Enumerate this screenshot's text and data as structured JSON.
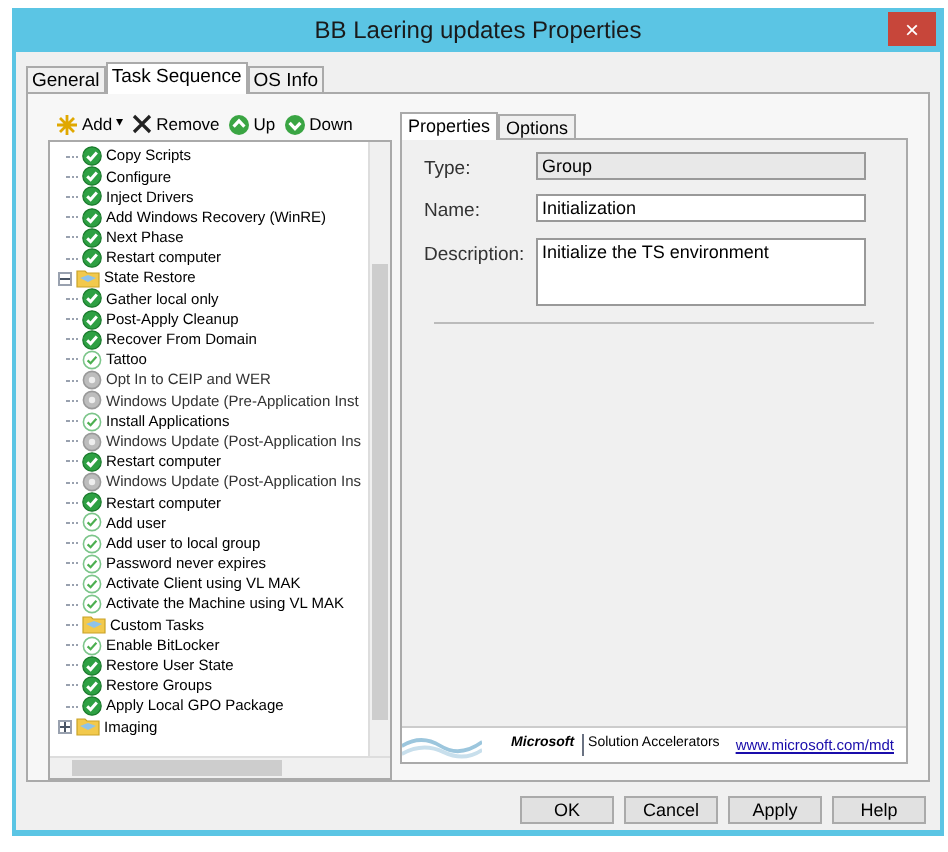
{
  "window": {
    "title": "BB Laering updates Properties",
    "close": "×"
  },
  "tabs": [
    {
      "label": "General",
      "selected": false
    },
    {
      "label": "Task Sequence",
      "selected": true
    },
    {
      "label": "OS Info",
      "selected": false
    }
  ],
  "toolbar": [
    {
      "kind": "add",
      "label": "Add",
      "caret": "▾"
    },
    {
      "kind": "remove",
      "label": "Remove"
    },
    {
      "kind": "up",
      "label": "Up"
    },
    {
      "kind": "down",
      "label": "Down"
    }
  ],
  "tree": [
    {
      "kind": "continued",
      "children": [
        {
          "kind": "step",
          "label": "Copy Scripts"
        },
        {
          "kind": "step",
          "label": "Configure"
        },
        {
          "kind": "step",
          "label": "Inject Drivers"
        },
        {
          "kind": "step",
          "label": "Add Windows Recovery (WinRE)"
        },
        {
          "kind": "step",
          "label": "Next Phase"
        },
        {
          "kind": "step",
          "label": "Restart computer"
        }
      ]
    },
    {
      "kind": "group",
      "label": "State Restore",
      "expanded": true,
      "children": [
        {
          "kind": "step",
          "label": "Gather local only"
        },
        {
          "kind": "step",
          "label": "Post-Apply Cleanup"
        },
        {
          "kind": "step",
          "label": "Recover From Domain"
        },
        {
          "kind": "optional-step",
          "label": "Tattoo"
        },
        {
          "kind": "disabled-step",
          "label": "Opt In to CEIP and WER"
        },
        {
          "kind": "disabled-step",
          "label": "Windows Update (Pre-Application Inst"
        },
        {
          "kind": "optional-step",
          "label": "Install Applications"
        },
        {
          "kind": "disabled-step",
          "label": "Windows Update (Post-Application Ins"
        },
        {
          "kind": "step",
          "label": "Restart computer"
        },
        {
          "kind": "disabled-step",
          "label": "Windows Update (Post-Application Ins"
        },
        {
          "kind": "step",
          "label": "Restart computer"
        },
        {
          "kind": "optional-step",
          "label": "Add user"
        },
        {
          "kind": "optional-step",
          "label": "Add user to local group"
        },
        {
          "kind": "optional-step",
          "label": "Password never expires"
        },
        {
          "kind": "optional-step",
          "label": "Activate Client using VL MAK"
        },
        {
          "kind": "optional-step",
          "label": "Activate the Machine using VL MAK"
        },
        {
          "kind": "folder",
          "label": "Custom Tasks"
        },
        {
          "kind": "optional-step",
          "label": "Enable BitLocker"
        },
        {
          "kind": "step",
          "label": "Restore User State"
        },
        {
          "kind": "step",
          "label": "Restore Groups"
        },
        {
          "kind": "step",
          "label": "Apply Local GPO Package"
        }
      ]
    },
    {
      "kind": "group",
      "label": "Imaging",
      "expanded": false
    }
  ],
  "properties_tabs": [
    {
      "label": "Properties",
      "selected": true
    },
    {
      "label": "Options",
      "selected": false
    }
  ],
  "fields": [
    {
      "kind": "readonly",
      "label": "Type:",
      "value": "Group"
    },
    {
      "kind": "text",
      "label": "Name:",
      "value": "Initialization"
    },
    {
      "kind": "multiline",
      "label": "Description:",
      "value": "Initialize the TS environment"
    }
  ],
  "footer": {
    "brand": "Microsoft",
    "product": "Solution Accelerators",
    "link": "www.microsoft.com/mdt"
  },
  "buttons": [
    "OK",
    "Cancel",
    "Apply",
    "Help"
  ]
}
